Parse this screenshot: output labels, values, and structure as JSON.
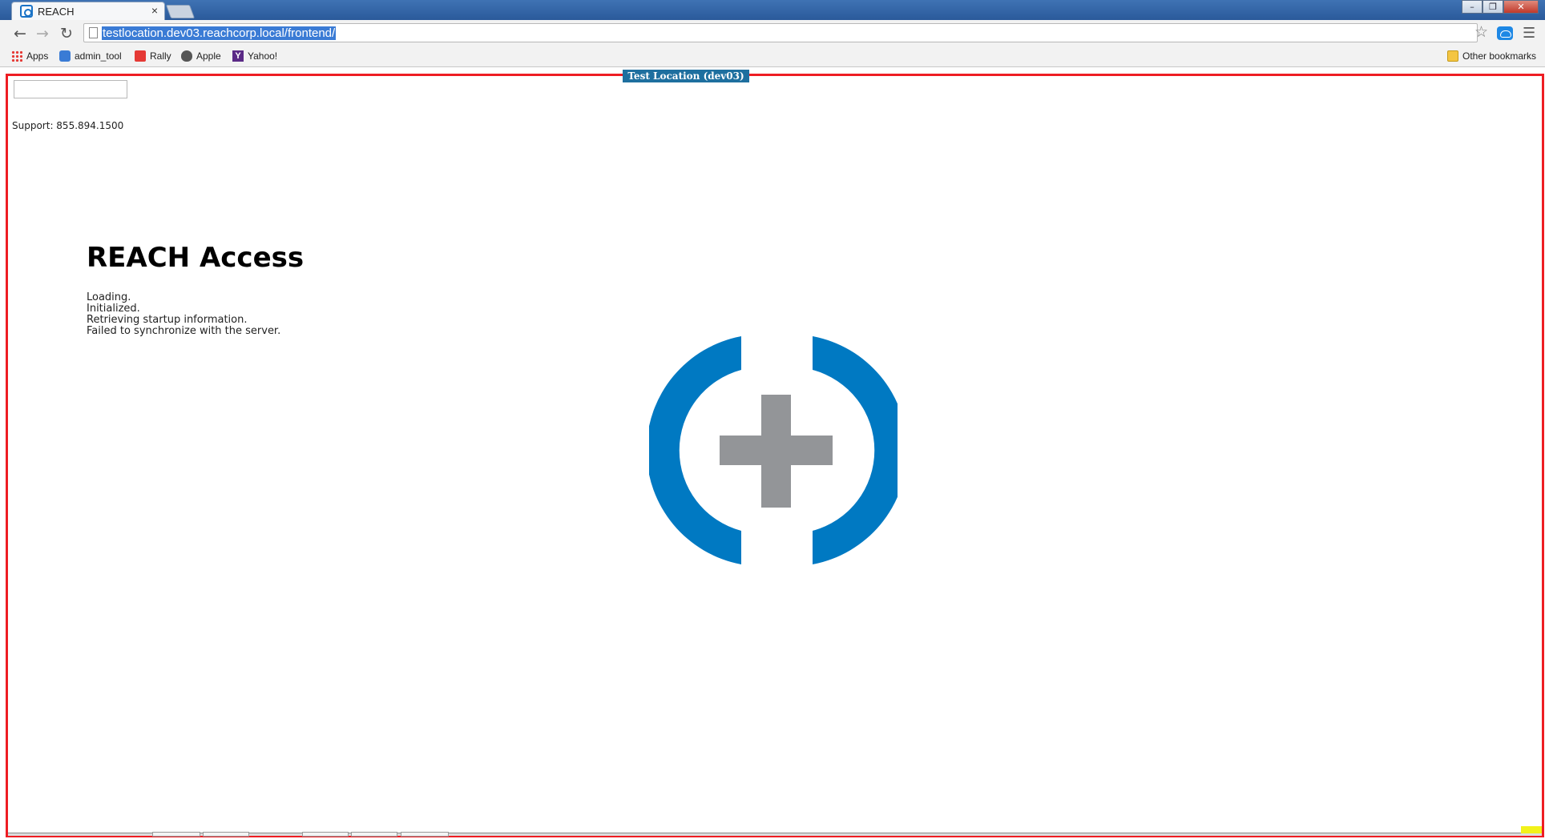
{
  "browser": {
    "tab_title": "REACH",
    "tab_close": "×",
    "url": "testlocation.dev03.reachcorp.local/frontend/",
    "bookmarks": [
      "Apps",
      "admin_tool",
      "Rally",
      "Apple",
      "Yahoo!"
    ],
    "other_bookmarks": "Other bookmarks",
    "icons": [
      "back-icon",
      "forward-icon",
      "reload-icon",
      "page-icon",
      "star-icon",
      "cloud-extension-icon",
      "menu-icon"
    ]
  },
  "page": {
    "env_badge": "Test Location (dev03)",
    "support": "Support: 855.894.1500",
    "title": "REACH Access",
    "status_log": [
      "Loading.",
      "Initialized.",
      "Retrieving startup information.",
      "Failed to synchronize with the server."
    ],
    "logo": "reach-logo-icon"
  },
  "colors": {
    "frame_border": "#ee1d23",
    "logo_blue": "#0079c2",
    "logo_gray": "#939598",
    "badge": "#1e6f9f"
  }
}
